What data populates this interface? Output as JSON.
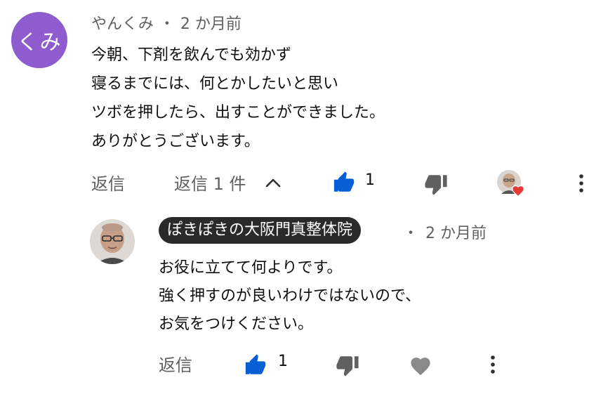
{
  "comment": {
    "avatar_text": "くみ",
    "author": "やんくみ",
    "separator": "・",
    "time": "2 か月前",
    "lines": [
      "今朝、下剤を飲んでも効かず",
      "寝るまでには、何とかしたいと思い",
      "ツボを押したら、出すことができました。",
      "ありがとうございます。"
    ],
    "actions": {
      "reply_label": "返信",
      "replies_toggle": "返信 1 件",
      "like_count": "1"
    }
  },
  "reply": {
    "author": "ぽきぽきの大阪門真整体院",
    "separator": "・",
    "time": "2 か月前",
    "lines": [
      "お役に立てて何よりです。",
      "強く押すのが良いわけではないので、",
      "お気をつけください。"
    ],
    "actions": {
      "reply_label": "返信",
      "like_count": "1"
    }
  },
  "icons": {
    "like": "thumb-up-icon",
    "dislike": "thumb-down-icon",
    "heart": "heart-icon",
    "more": "more-vertical-icon",
    "chevron": "chevron-up-icon"
  },
  "colors": {
    "avatar_bg": "#8e5ccf",
    "like_active": "#065fd4",
    "heart_red": "#e53935",
    "chip_bg": "#2a2a2a"
  }
}
